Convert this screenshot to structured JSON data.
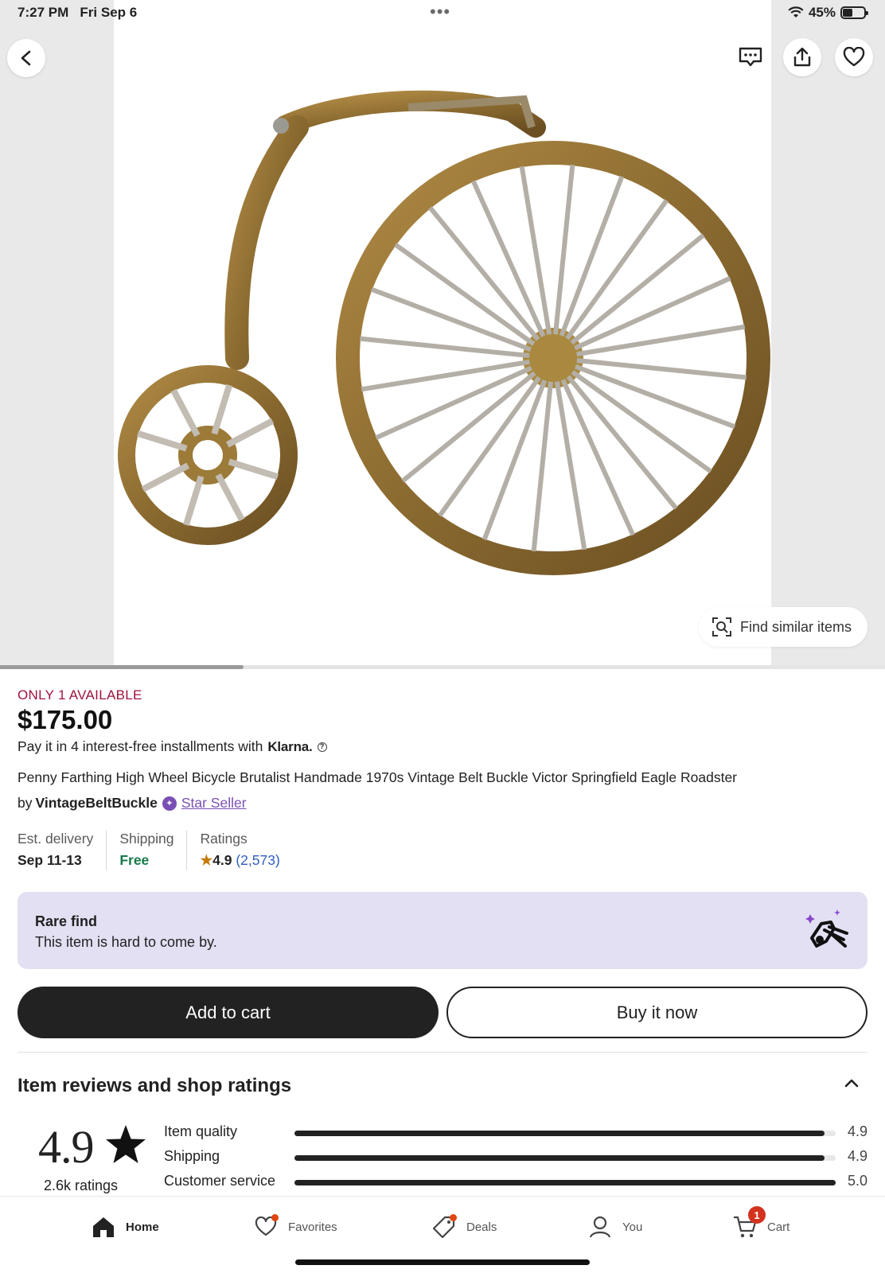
{
  "status_bar": {
    "time": "7:27 PM",
    "date": "Fri Sep 6",
    "battery": "45%",
    "battery_level": 0.45
  },
  "hero": {
    "image_alt": "Penny farthing bicycle belt buckle",
    "find_similar": "Find similar items",
    "gallery_progress": 0.25
  },
  "listing": {
    "availability": "ONLY 1 AVAILABLE",
    "price": "$175.00",
    "klarna_text": "Pay it in 4 interest-free installments with",
    "klarna_brand": "Klarna.",
    "title": "Penny Farthing High Wheel Bicycle Brutalist Handmade 1970s Vintage Belt Buckle Victor Springfield Eagle Roadster",
    "by": "by",
    "seller": "VintageBeltBuckle",
    "seller_badge": "Star Seller"
  },
  "stats": {
    "delivery_label": "Est. delivery",
    "delivery_value": "Sep 11-13",
    "shipping_label": "Shipping",
    "shipping_value": "Free",
    "ratings_label": "Ratings",
    "ratings_value": "4.9",
    "ratings_count": "(2,573)"
  },
  "rare_find": {
    "title": "Rare find",
    "description": "This item is hard to come by."
  },
  "actions": {
    "add_to_cart": "Add to cart",
    "buy_now": "Buy it now"
  },
  "reviews": {
    "heading": "Item reviews and shop ratings",
    "overall": "4.9",
    "count": "2.6k ratings",
    "rows": [
      {
        "label": "Item quality",
        "value": "4.9",
        "fill": 0.98
      },
      {
        "label": "Shipping",
        "value": "4.9",
        "fill": 0.98
      },
      {
        "label": "Customer service",
        "value": "5.0",
        "fill": 1.0
      }
    ]
  },
  "nav": {
    "home": "Home",
    "favorites": "Favorites",
    "deals": "Deals",
    "you": "You",
    "cart": "Cart",
    "cart_count": "1"
  },
  "colors": {
    "availability": "#a0123c",
    "star_seller": "#7a4fb5",
    "free_shipping": "#167a4a",
    "rating_link": "#2f5fbf",
    "rare_card_bg": "#e3e0f3",
    "primary_button": "#222222"
  }
}
